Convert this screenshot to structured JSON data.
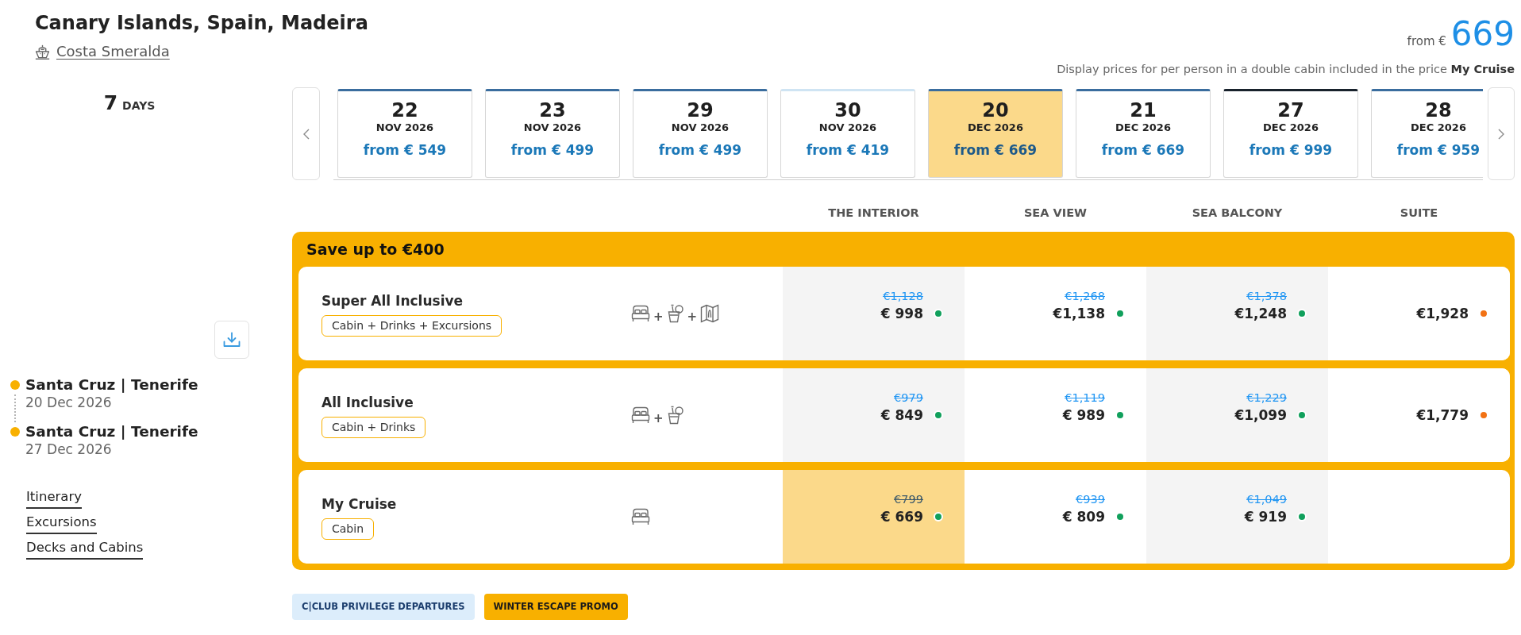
{
  "header": {
    "title": "Canary Islands, Spain, Madeira",
    "ship": "Costa Smeralda",
    "price": {
      "label": "from €",
      "amount": "669"
    },
    "note": "Display prices for per person in a double cabin included in the price **My Cruise**"
  },
  "duration": {
    "number": "7",
    "unit": "DAYS"
  },
  "dates": [
    {
      "day": "22",
      "month": "NOV 2026",
      "price": "from € 549",
      "color": "#3a6d9e",
      "selected": false
    },
    {
      "day": "23",
      "month": "NOV 2026",
      "price": "from € 499",
      "color": "#3a6d9e",
      "selected": false
    },
    {
      "day": "29",
      "month": "NOV 2026",
      "price": "from € 499",
      "color": "#3a6d9e",
      "selected": false
    },
    {
      "day": "30",
      "month": "NOV 2026",
      "price": "from € 419",
      "color": "#cfe4f3",
      "selected": false
    },
    {
      "day": "20",
      "month": "DEC 2026",
      "price": "from € 669",
      "color": "#3a6d9e",
      "selected": true
    },
    {
      "day": "21",
      "month": "DEC 2026",
      "price": "from € 669",
      "color": "#3a6d9e",
      "selected": false
    },
    {
      "day": "27",
      "month": "DEC 2026",
      "price": "from € 999",
      "color": "#18222c",
      "selected": false
    },
    {
      "day": "28",
      "month": "DEC 2026",
      "price": "from € 959",
      "color": "#3a6d9e",
      "selected": false
    }
  ],
  "columns": [
    "THE INTERIOR",
    "SEA VIEW",
    "SEA BALCONY",
    "SUITE"
  ],
  "promo": {
    "title": "Save up to €400",
    "packages": [
      {
        "name": "Super All Inclusive",
        "tag": "Cabin + Drinks + Excursions",
        "inclusions": [
          {
            "kind": "bed"
          },
          {
            "kind": "plus",
            "label": "+"
          },
          {
            "kind": "drink"
          },
          {
            "kind": "plus",
            "label": "+"
          },
          {
            "kind": "map"
          }
        ],
        "prices": [
          {
            "old": "€1,128",
            "price": "€ 998",
            "color": "#11a05c",
            "selected": false
          },
          {
            "old": "€1,268",
            "price": "€1,138",
            "color": "#11a05c",
            "selected": false
          },
          {
            "old": "€1,378",
            "price": "€1,248",
            "color": "#11a05c",
            "selected": false
          },
          {
            "price": "€1,928",
            "color": "#f27214",
            "selected": false
          }
        ]
      },
      {
        "name": "All Inclusive",
        "tag": "Cabin + Drinks",
        "inclusions": [
          {
            "kind": "bed"
          },
          {
            "kind": "plus",
            "label": "+"
          },
          {
            "kind": "drink"
          }
        ],
        "prices": [
          {
            "old": "€979",
            "price": "€ 849",
            "color": "#11a05c",
            "selected": false
          },
          {
            "old": "€1,119",
            "price": "€ 989",
            "color": "#11a05c",
            "selected": false
          },
          {
            "old": "€1,229",
            "price": "€1,099",
            "color": "#11a05c",
            "selected": false
          },
          {
            "price": "€1,779",
            "color": "#f27214",
            "selected": false
          }
        ]
      },
      {
        "name": "My Cruise",
        "tag": "Cabin",
        "inclusions": [
          {
            "kind": "bed"
          }
        ],
        "prices": [
          {
            "old": "€799",
            "price": "€ 669",
            "color": "#11a05c",
            "selected": true
          },
          {
            "old": "€939",
            "price": "€ 809",
            "color": "#11a05c",
            "selected": false
          },
          {
            "old": "€1,049",
            "price": "€ 919",
            "color": "#11a05c",
            "selected": false
          }
        ]
      }
    ]
  },
  "itinerary": [
    {
      "port": "Santa Cruz | Tenerife",
      "date": "20 Dec 2026"
    },
    {
      "port": "Santa Cruz | Tenerife",
      "date": "27 Dec 2026"
    }
  ],
  "links": [
    "Itinerary",
    "Excursions",
    "Decks and Cabins"
  ],
  "badges": [
    {
      "label": "C|CLUB PRIVILEGE DEPARTURES",
      "kind": "club"
    },
    {
      "label": "WINTER ESCAPE PROMO",
      "kind": "promo"
    }
  ]
}
